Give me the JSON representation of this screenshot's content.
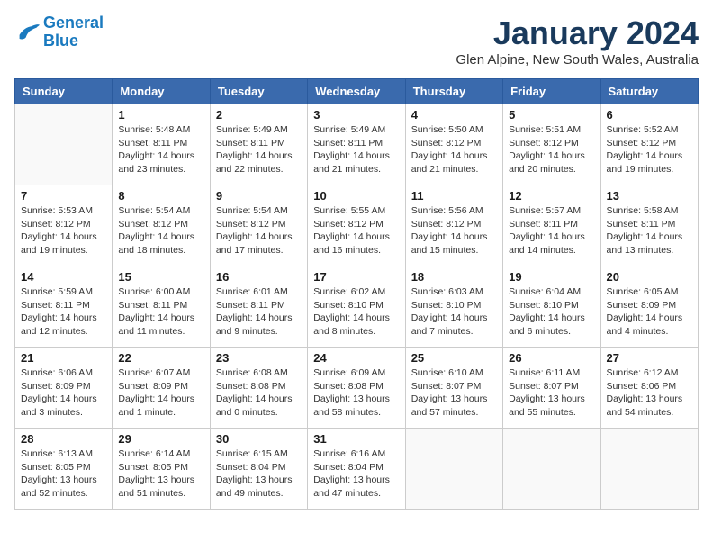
{
  "header": {
    "logo_line1": "General",
    "logo_line2": "Blue",
    "month_title": "January 2024",
    "location": "Glen Alpine, New South Wales, Australia"
  },
  "weekdays": [
    "Sunday",
    "Monday",
    "Tuesday",
    "Wednesday",
    "Thursday",
    "Friday",
    "Saturday"
  ],
  "weeks": [
    [
      {
        "day": "",
        "info": ""
      },
      {
        "day": "1",
        "info": "Sunrise: 5:48 AM\nSunset: 8:11 PM\nDaylight: 14 hours\nand 23 minutes."
      },
      {
        "day": "2",
        "info": "Sunrise: 5:49 AM\nSunset: 8:11 PM\nDaylight: 14 hours\nand 22 minutes."
      },
      {
        "day": "3",
        "info": "Sunrise: 5:49 AM\nSunset: 8:11 PM\nDaylight: 14 hours\nand 21 minutes."
      },
      {
        "day": "4",
        "info": "Sunrise: 5:50 AM\nSunset: 8:12 PM\nDaylight: 14 hours\nand 21 minutes."
      },
      {
        "day": "5",
        "info": "Sunrise: 5:51 AM\nSunset: 8:12 PM\nDaylight: 14 hours\nand 20 minutes."
      },
      {
        "day": "6",
        "info": "Sunrise: 5:52 AM\nSunset: 8:12 PM\nDaylight: 14 hours\nand 19 minutes."
      }
    ],
    [
      {
        "day": "7",
        "info": "Sunrise: 5:53 AM\nSunset: 8:12 PM\nDaylight: 14 hours\nand 19 minutes."
      },
      {
        "day": "8",
        "info": "Sunrise: 5:54 AM\nSunset: 8:12 PM\nDaylight: 14 hours\nand 18 minutes."
      },
      {
        "day": "9",
        "info": "Sunrise: 5:54 AM\nSunset: 8:12 PM\nDaylight: 14 hours\nand 17 minutes."
      },
      {
        "day": "10",
        "info": "Sunrise: 5:55 AM\nSunset: 8:12 PM\nDaylight: 14 hours\nand 16 minutes."
      },
      {
        "day": "11",
        "info": "Sunrise: 5:56 AM\nSunset: 8:12 PM\nDaylight: 14 hours\nand 15 minutes."
      },
      {
        "day": "12",
        "info": "Sunrise: 5:57 AM\nSunset: 8:11 PM\nDaylight: 14 hours\nand 14 minutes."
      },
      {
        "day": "13",
        "info": "Sunrise: 5:58 AM\nSunset: 8:11 PM\nDaylight: 14 hours\nand 13 minutes."
      }
    ],
    [
      {
        "day": "14",
        "info": "Sunrise: 5:59 AM\nSunset: 8:11 PM\nDaylight: 14 hours\nand 12 minutes."
      },
      {
        "day": "15",
        "info": "Sunrise: 6:00 AM\nSunset: 8:11 PM\nDaylight: 14 hours\nand 11 minutes."
      },
      {
        "day": "16",
        "info": "Sunrise: 6:01 AM\nSunset: 8:11 PM\nDaylight: 14 hours\nand 9 minutes."
      },
      {
        "day": "17",
        "info": "Sunrise: 6:02 AM\nSunset: 8:10 PM\nDaylight: 14 hours\nand 8 minutes."
      },
      {
        "day": "18",
        "info": "Sunrise: 6:03 AM\nSunset: 8:10 PM\nDaylight: 14 hours\nand 7 minutes."
      },
      {
        "day": "19",
        "info": "Sunrise: 6:04 AM\nSunset: 8:10 PM\nDaylight: 14 hours\nand 6 minutes."
      },
      {
        "day": "20",
        "info": "Sunrise: 6:05 AM\nSunset: 8:09 PM\nDaylight: 14 hours\nand 4 minutes."
      }
    ],
    [
      {
        "day": "21",
        "info": "Sunrise: 6:06 AM\nSunset: 8:09 PM\nDaylight: 14 hours\nand 3 minutes."
      },
      {
        "day": "22",
        "info": "Sunrise: 6:07 AM\nSunset: 8:09 PM\nDaylight: 14 hours\nand 1 minute."
      },
      {
        "day": "23",
        "info": "Sunrise: 6:08 AM\nSunset: 8:08 PM\nDaylight: 14 hours\nand 0 minutes."
      },
      {
        "day": "24",
        "info": "Sunrise: 6:09 AM\nSunset: 8:08 PM\nDaylight: 13 hours\nand 58 minutes."
      },
      {
        "day": "25",
        "info": "Sunrise: 6:10 AM\nSunset: 8:07 PM\nDaylight: 13 hours\nand 57 minutes."
      },
      {
        "day": "26",
        "info": "Sunrise: 6:11 AM\nSunset: 8:07 PM\nDaylight: 13 hours\nand 55 minutes."
      },
      {
        "day": "27",
        "info": "Sunrise: 6:12 AM\nSunset: 8:06 PM\nDaylight: 13 hours\nand 54 minutes."
      }
    ],
    [
      {
        "day": "28",
        "info": "Sunrise: 6:13 AM\nSunset: 8:05 PM\nDaylight: 13 hours\nand 52 minutes."
      },
      {
        "day": "29",
        "info": "Sunrise: 6:14 AM\nSunset: 8:05 PM\nDaylight: 13 hours\nand 51 minutes."
      },
      {
        "day": "30",
        "info": "Sunrise: 6:15 AM\nSunset: 8:04 PM\nDaylight: 13 hours\nand 49 minutes."
      },
      {
        "day": "31",
        "info": "Sunrise: 6:16 AM\nSunset: 8:04 PM\nDaylight: 13 hours\nand 47 minutes."
      },
      {
        "day": "",
        "info": ""
      },
      {
        "day": "",
        "info": ""
      },
      {
        "day": "",
        "info": ""
      }
    ]
  ]
}
